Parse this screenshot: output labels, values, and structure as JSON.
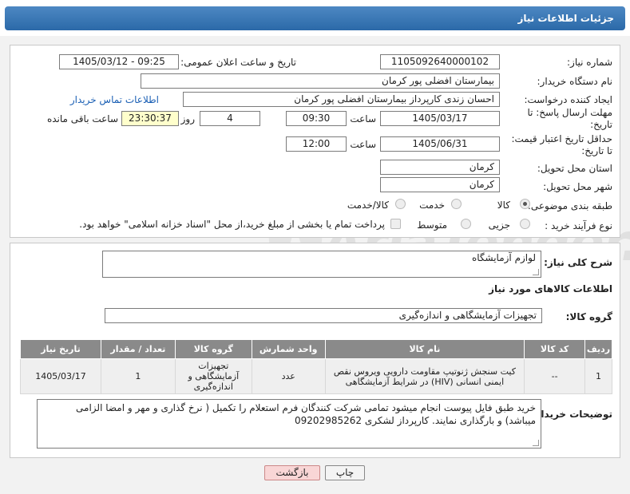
{
  "header": {
    "title": "جزئیات اطلاعات نیاز"
  },
  "form": {
    "need_number_label": "شماره نیاز:",
    "need_number": "1105092640000102",
    "announce_label": "تاریخ و ساعت اعلان عمومی:",
    "announce_value": "1405/03/12 - 09:25",
    "buyer_org_label": "نام دستگاه خریدار:",
    "buyer_org": "بیمارستان افضلی پور کرمان",
    "requester_label": "ایجاد کننده درخواست:",
    "requester": "احسان زندی  کارپرداز بیمارستان افضلی پور کرمان",
    "buyer_contact_link": "اطلاعات تماس خریدار",
    "deadline_label": "مهلت ارسال پاسخ: تا تاریخ:",
    "deadline_date": "1405/03/17",
    "time_label": "ساعت",
    "deadline_time": "09:30",
    "days_value": "4",
    "days_label": "روز و",
    "remaining_value": "23:30:37",
    "remaining_label": "ساعت باقی مانده",
    "validity_label": "حداقل تاریخ اعتبار قیمت: تا تاریخ:",
    "validity_date": "1405/06/31",
    "validity_time": "12:00",
    "province_label": "استان محل تحویل:",
    "province": "کرمان",
    "city_label": "شهر محل تحویل:",
    "city": "کرمان",
    "category_label": "طبقه بندی موضوعی:",
    "category_options": [
      "کالا",
      "خدمت",
      "کالا/خدمت"
    ],
    "process_label": "نوع فرآیند خرید :",
    "process_options": [
      "جزیی",
      "متوسط"
    ],
    "payment_note": "پرداخت تمام یا بخشی از مبلغ خرید،از محل \"اسناد خزانه اسلامی\" خواهد بود."
  },
  "details": {
    "summary_label": "شرح کلی نیاز:",
    "summary": "لوازم آزمایشگاه",
    "goods_info_title": "اطلاعات کالاهای مورد نیاز",
    "group_label": "گروه کالا:",
    "group_value": "تجهیزات آزمایشگاهی و اندازه‌گیری",
    "columns": [
      "ردیف",
      "کد کالا",
      "نام کالا",
      "واحد شمارش",
      "گروه کالا",
      "تعداد / مقدار",
      "تاریخ نیاز"
    ],
    "rows": [
      [
        "1",
        "--",
        "کیت سنجش ژنوتیپ مقاومت دارویی ویروس نقص ایمنی انسانی (HIV) در شرایط آزمایشگاهی",
        "عدد",
        "تجهیزات آزمایشگاهی و اندازه‌گیری",
        "1",
        "1405/03/17"
      ]
    ],
    "buyer_notes_label": "توضیحات خریدار:",
    "buyer_notes": "خرید طبق فایل پیوست انجام میشود تمامی شرکت کنندگان فرم استعلام را تکمیل ( نرخ گذاری و مهر و امضا الزامی میباشد) و بارگذاری نمایند. کارپرداز لشکری 09202985262"
  },
  "buttons": {
    "print": "چاپ",
    "back": "بازگشت"
  },
  "watermark": {
    "text": "AriaTender.net"
  }
}
